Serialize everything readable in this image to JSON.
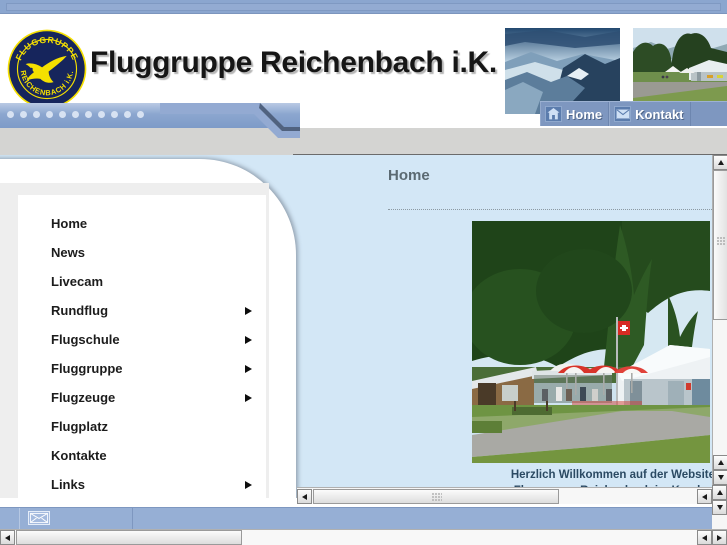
{
  "window": {
    "top_strip_color": "#8ba6cf"
  },
  "header": {
    "site_title": "Fluggruppe Reichenbach i.K.",
    "logo": {
      "icon": "club-emblem-bird-icon",
      "top_arc_text": "FLUGGRUPPE",
      "bottom_arc_text": "REICHENBACH i.K.",
      "disc_color": "#16255c",
      "bird_color": "#f5e000",
      "ring_color": "#f5e000"
    },
    "photos": [
      {
        "name": "mountains-aerial-photo",
        "alt": "Aerial view of clouds over mountain ridges"
      },
      {
        "name": "airfield-photo",
        "alt": "Airfield with hangar, tents and parked aircraft"
      }
    ]
  },
  "nav": {
    "items": [
      {
        "label": "Home",
        "icon": "house-icon"
      },
      {
        "label": "Kontakt",
        "icon": "envelope-icon"
      }
    ]
  },
  "sidebar": {
    "items": [
      {
        "label": "Home",
        "has_submenu": false
      },
      {
        "label": "News",
        "has_submenu": false
      },
      {
        "label": "Livecam",
        "has_submenu": false
      },
      {
        "label": "Rundflug",
        "has_submenu": true
      },
      {
        "label": "Flugschule",
        "has_submenu": true
      },
      {
        "label": "Fluggruppe",
        "has_submenu": true
      },
      {
        "label": "Flugzeuge",
        "has_submenu": true
      },
      {
        "label": "Flugplatz",
        "has_submenu": false
      },
      {
        "label": "Kontakte",
        "has_submenu": false
      },
      {
        "label": "Links",
        "has_submenu": true
      }
    ]
  },
  "content": {
    "heading": "Home",
    "photo": {
      "name": "clubhouse-terrace-photo",
      "alt": "Airfield restaurant terrace with red umbrellas, Swiss flag and hangar"
    },
    "welcome_line1": "Herzlich Willkommen auf der Website",
    "welcome_line2": "Fluggruppe Reichenbach im Kandert"
  },
  "footer": {
    "mail_icon": "envelope-icon"
  },
  "scrollbars": {
    "inner_vertical": {
      "up": "scroll-up-arrow",
      "down": "scroll-down-arrow"
    },
    "inner_horizontal": {
      "left": "scroll-left-arrow",
      "right": "scroll-right-arrow"
    },
    "page_vertical": {
      "up": "scroll-up-arrow",
      "down": "scroll-down-arrow"
    },
    "page_horizontal": {
      "left": "scroll-left-arrow",
      "right": "scroll-right-arrow"
    }
  }
}
